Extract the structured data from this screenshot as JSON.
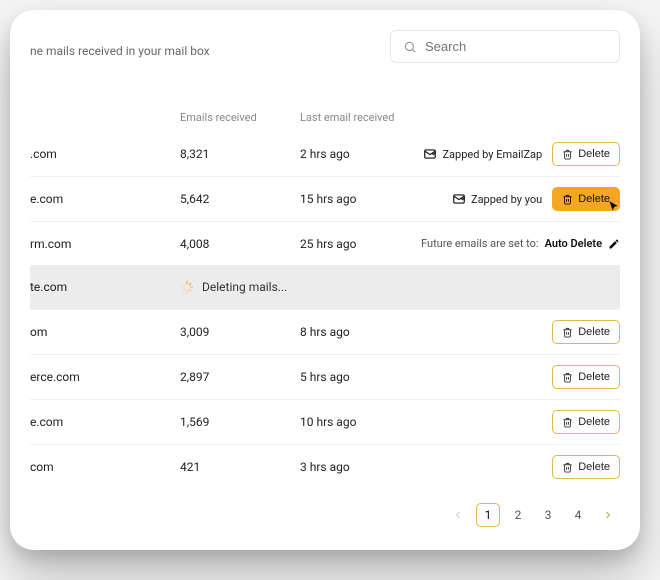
{
  "header": {
    "subtitle": "ne mails received in your mail box"
  },
  "search": {
    "placeholder": "Search"
  },
  "columns": {
    "emails": "Emails received",
    "last": "Last email received"
  },
  "zapped_by_emailzap": "Zapped by EmailZap",
  "zapped_by_you": "Zapped by you",
  "future_status_prefix": "Future emails are set to:",
  "future_status_value": "Auto Delete",
  "delete_label": "Delete",
  "deleting_label": "Deleting mails...",
  "rows": [
    {
      "domain": ".com",
      "count": "8,321",
      "last": "2 hrs ago",
      "zap": "emailzap",
      "delete": true
    },
    {
      "domain": "e.com",
      "count": "5,642",
      "last": "15 hrs ago",
      "zap": "you",
      "delete": "active"
    },
    {
      "domain": "rm.com",
      "count": "4,008",
      "last": "25 hrs ago",
      "status": true
    },
    {
      "domain": "te.com",
      "deleting": true
    },
    {
      "domain": "om",
      "count": "3,009",
      "last": "8 hrs ago",
      "delete": true
    },
    {
      "domain": "erce.com",
      "count": "2,897",
      "last": "5 hrs ago",
      "delete": true
    },
    {
      "domain": "e.com",
      "count": "1,569",
      "last": "10 hrs ago",
      "delete": true
    },
    {
      "domain": "com",
      "count": "421",
      "last": "3 hrs ago",
      "delete": true
    }
  ],
  "pagination": {
    "pages": [
      "1",
      "2",
      "3",
      "4"
    ],
    "current": "1"
  }
}
